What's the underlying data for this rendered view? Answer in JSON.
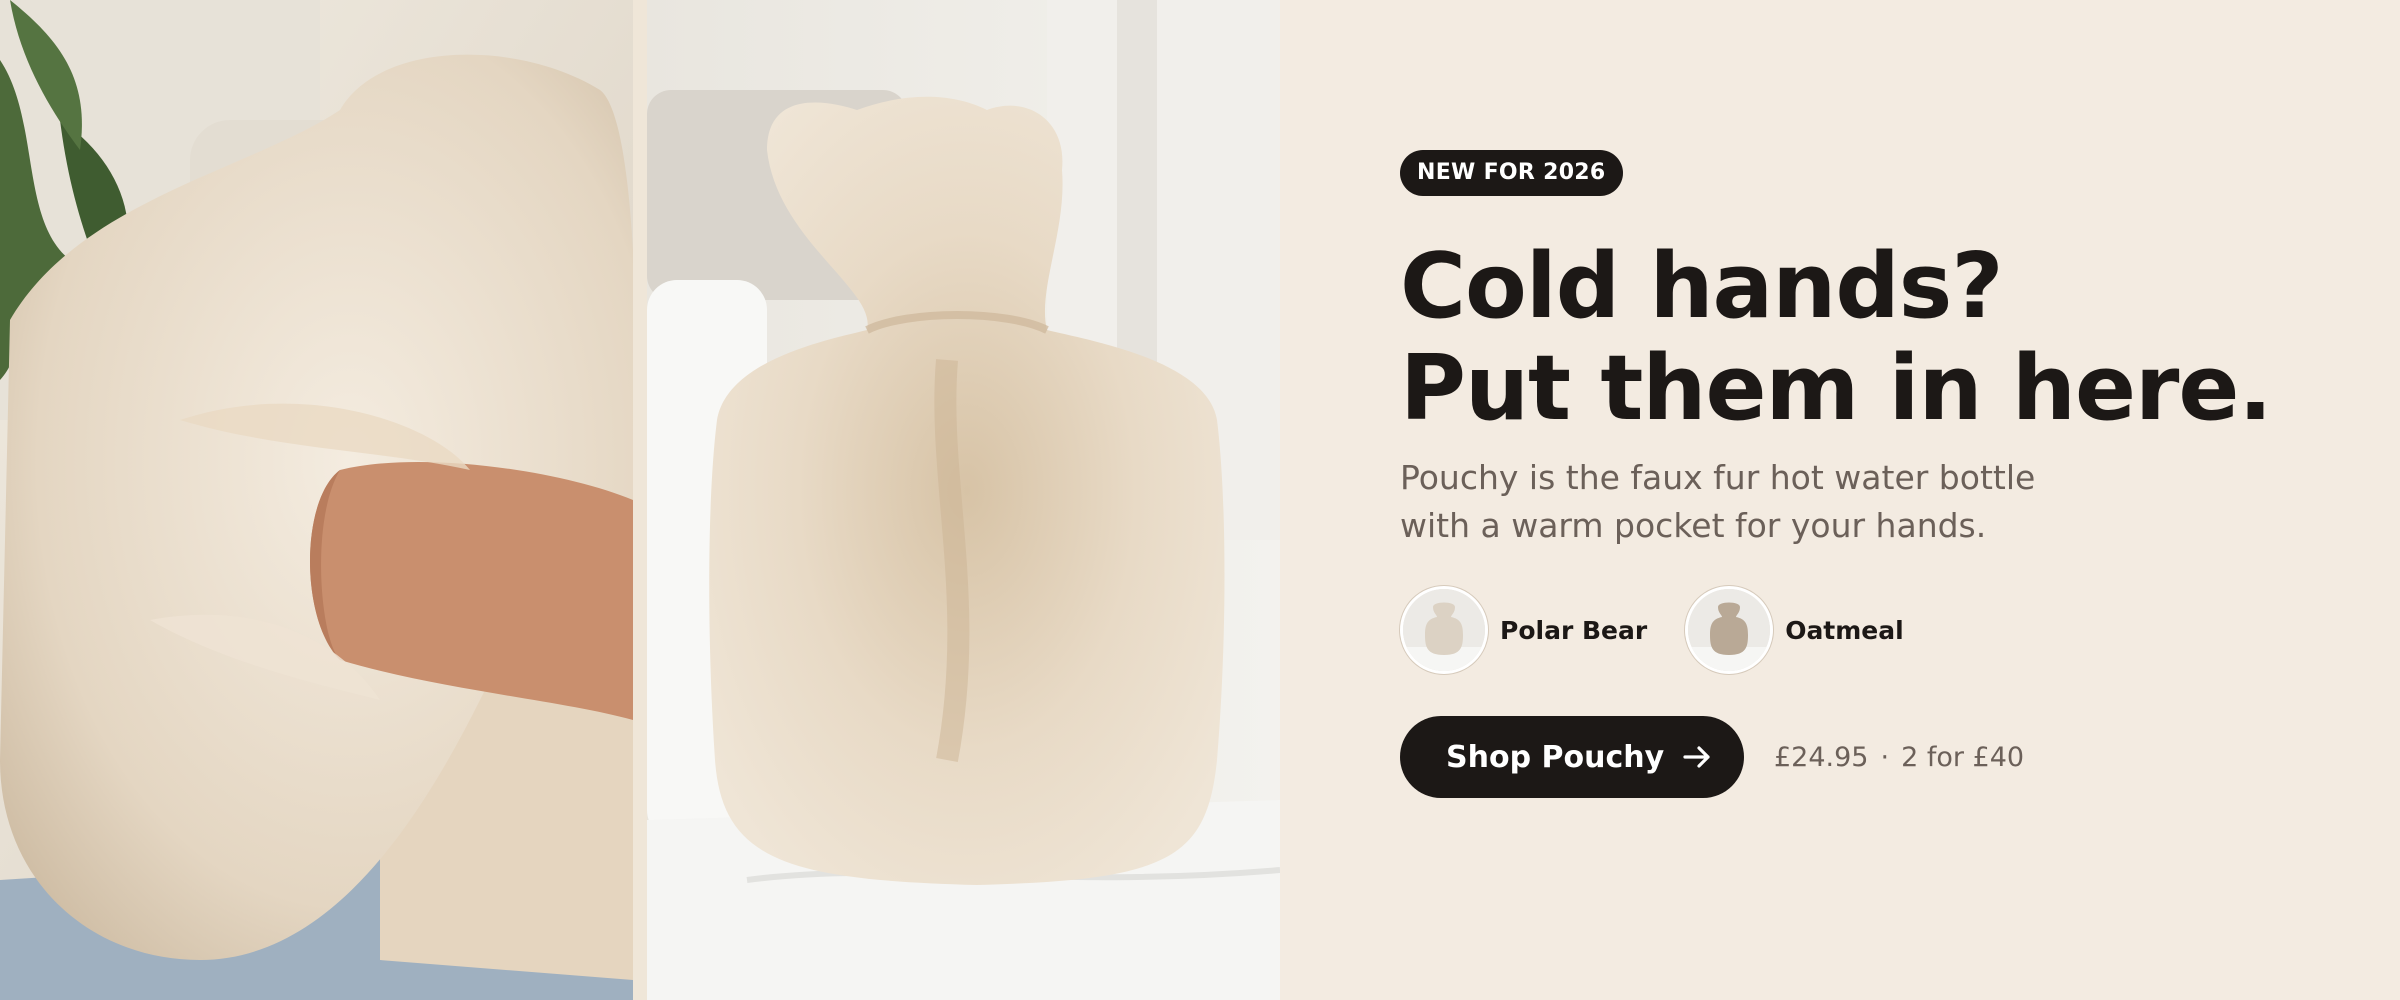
{
  "hero": {
    "badge": "NEW FOR 2026",
    "headline_line1": "Cold hands?",
    "headline_line2": "Put them in here.",
    "subtitle": "Pouchy is the faux fur hot water bottle with a warm pocket for your hands."
  },
  "variants": [
    {
      "name": "Polar Bear",
      "swatch": "#dcd2c4"
    },
    {
      "name": "Oatmeal",
      "swatch": "#b9a996"
    }
  ],
  "cta": {
    "label": "Shop Pouchy",
    "icon": "arrow-right-icon"
  },
  "pricing": {
    "price": "£24.95",
    "separator": "·",
    "offer": "2 for £40"
  },
  "colors": {
    "background": "#f3ebe1",
    "primary": "#1c1816",
    "muted_text": "#6b6059",
    "fur": "#e8dccb"
  }
}
